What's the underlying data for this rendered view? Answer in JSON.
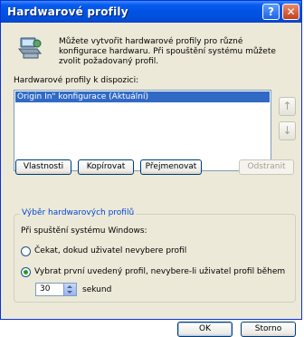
{
  "window": {
    "title": "Hardwarové profily",
    "help_icon": "question-mark",
    "close_icon": "x"
  },
  "intro": {
    "icon": "hardware-profile-icon",
    "text": "Můžete vytvořit hardwarové profily pro různé konfigurace hardwaru. Při spouštění systému můžete zvolit požadovaný profil."
  },
  "profiles": {
    "label": "Hardwarové profily k dispozici:",
    "items": [
      "Origin In\" konfigurace (Aktuální)"
    ],
    "selected_index": 0,
    "move_up_icon": "arrow-up",
    "move_down_icon": "arrow-down"
  },
  "buttons": {
    "properties": "Vlastnosti",
    "copy": "Kopírovat",
    "rename": "Přejmenovat",
    "remove": "Odstranit"
  },
  "selection": {
    "group_title": "Výběr hardwarových profilů",
    "startup_label": "Při spuštění systému Windows:",
    "option_wait": "Čekat, dokud uživatel nevybere profil",
    "option_auto": "Vybrat první uvedený profil, nevybere-li uživatel profil během",
    "selected_option": "auto",
    "timeout_value": "30",
    "timeout_unit": "sekund"
  },
  "footer": {
    "ok": "OK",
    "cancel": "Storno"
  },
  "colors": {
    "title_bar": "#0054e3",
    "selection": "#316ac5",
    "group_title": "#0046d5",
    "dialog_bg": "#ece9d8"
  }
}
